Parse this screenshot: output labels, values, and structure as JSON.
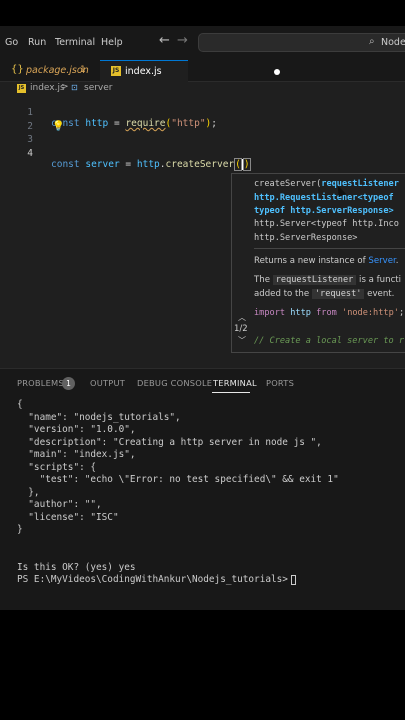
{
  "menu": {
    "items": [
      "Go",
      "Run",
      "Terminal",
      "Help"
    ]
  },
  "nav": {
    "back": "←",
    "forward": "→"
  },
  "command_center": {
    "text": "Nodejs_tutorials"
  },
  "tabs": [
    {
      "label": "package.json",
      "badge": "1"
    },
    {
      "label": "index.js",
      "icon_text": "JS"
    }
  ],
  "breadcrumb": {
    "file": "index.js",
    "separator": ">",
    "symbol": "server"
  },
  "editor": {
    "line_numbers": [
      "1",
      "2",
      "3",
      "4"
    ],
    "line1": {
      "kw": "const",
      "name": "http",
      "eq": "=",
      "fn": "require",
      "lp": "(",
      "str": "\"http\"",
      "rp": ")",
      "semi": ";"
    },
    "line4": {
      "kw": "const",
      "name": "server",
      "eq": "=",
      "obj": "http",
      "dot": ".",
      "fn": "createServer",
      "lp": "(",
      "rp": ")"
    }
  },
  "signature_help": {
    "sig_fn": "createServer(",
    "sig_param": "requestListener",
    "sig_l2": "http.RequestListener<typeof",
    "sig_l3": "typeof http.ServerResponse>",
    "sig_l4": "http.Server<typeof http.Inco",
    "sig_l5": "http.ServerResponse>",
    "desc_prefix": "Returns a new instance of ",
    "desc_link": "Server",
    "desc_suffix": ".",
    "p2_the": "The ",
    "p2_code": "requestListener",
    "p2_rest": " is a functi",
    "p3_prefix": "added to the ",
    "p3_code": "'request'",
    "p3_suffix": " event.",
    "import_kw": "import",
    "import_mod": "http",
    "import_from": "from",
    "import_str": "'node:http'",
    "import_semi": ";",
    "comment": "// Create a local server to r",
    "comment2": "                           ",
    "counter": "1/2"
  },
  "panel": {
    "tabs": [
      "PROBLEMS",
      "OUTPUT",
      "DEBUG CONSOLE",
      "TERMINAL",
      "PORTS"
    ],
    "problems_count": "1",
    "terminal_lines": [
      "{",
      "  \"name\": \"nodejs_tutorials\",",
      "  \"version\": \"1.0.0\",",
      "  \"description\": \"Creating a http server in node js \",",
      "  \"main\": \"index.js\",",
      "  \"scripts\": {",
      "    \"test\": \"echo \\\"Error: no test specified\\\" && exit 1\"",
      "  },",
      "  \"author\": \"\",",
      "  \"license\": \"ISC\"",
      "}",
      "",
      "",
      "Is this OK? (yes) yes",
      "PS E:\\MyVideos\\CodingWithAnkur\\Nodejs_tutorials>"
    ]
  },
  "colors": {
    "accent": "#0078d4",
    "keyword": "#569cd6",
    "variable": "#4fc1ff",
    "function": "#dcdcaa",
    "string": "#ce9178",
    "modified": "#d9a557"
  }
}
